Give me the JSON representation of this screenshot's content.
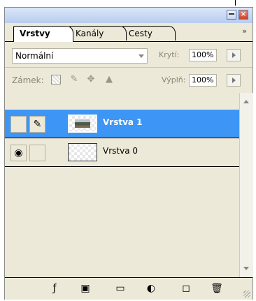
{
  "tabs": [
    {
      "label": "Vrstvy",
      "active": true
    },
    {
      "label": "Kanály",
      "active": false
    },
    {
      "label": "Cesty",
      "active": false
    }
  ],
  "more_label": "»",
  "blend_mode": "Normální",
  "opacity": {
    "label": "Krytí:",
    "value": "100%"
  },
  "lock": {
    "label": "Zámek:"
  },
  "fill": {
    "label": "Výplň:",
    "value": "100%"
  },
  "layers": [
    {
      "name": "Vrstva 1",
      "selected": true,
      "visible": false
    },
    {
      "name": "Vrstva 0",
      "selected": false,
      "visible": true
    }
  ],
  "colors": {
    "selection": "#3d96f5",
    "panel": "#ece9d8"
  }
}
